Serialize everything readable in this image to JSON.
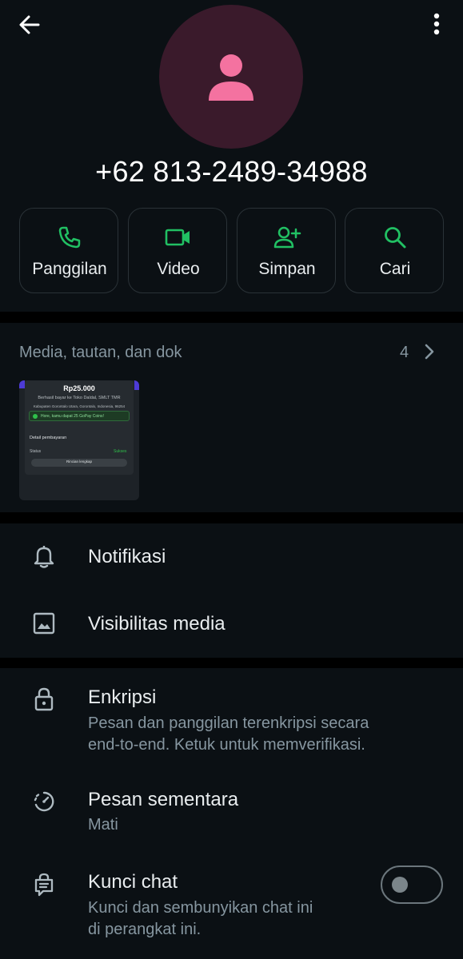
{
  "header": {
    "back_icon": "arrow-left-icon",
    "menu_icon": "more-vert-icon",
    "avatar_icon": "person-icon",
    "avatar_color": "#3a1a2b",
    "avatar_icon_color": "#f472a0",
    "phone": "+62 813-2489-34988"
  },
  "actions": [
    {
      "label": "Panggilan",
      "icon": "phone-icon"
    },
    {
      "label": "Video",
      "icon": "video-icon"
    },
    {
      "label": "Simpan",
      "icon": "add-person-icon"
    },
    {
      "label": "Cari",
      "icon": "search-icon"
    }
  ],
  "accent_color": "#21c063",
  "media": {
    "title": "Media, tautan, dan dok",
    "count": "4",
    "thumbnail": {
      "amount": "Rp25.000",
      "line1": "Berhasil bayar ke Toko Daldal, SMLT TMR",
      "line2": "Kabupaten Gorontalo Utara, Gorontalo, Indonesia, 96254",
      "promo": "Hore, kamu dapat 25 GoPay Coins!",
      "detail": "Detail pembayaran",
      "status_label": "Status",
      "status_value": "Sukses",
      "button": "Rincian lengkap"
    }
  },
  "settings1": [
    {
      "title": "Notifikasi",
      "icon": "bell-icon"
    },
    {
      "title": "Visibilitas media",
      "icon": "image-icon"
    }
  ],
  "settings2": {
    "encryption": {
      "title": "Enkripsi",
      "sub1": "Pesan dan panggilan terenkripsi secara",
      "sub2": "end-to-end. Ketuk untuk memverifikasi.",
      "icon": "lock-icon"
    },
    "disappearing": {
      "title": "Pesan sementara",
      "sub": "Mati",
      "icon": "timer-icon"
    },
    "chat_lock": {
      "title": "Kunci chat",
      "sub1": "Kunci dan sembunyikan chat ini",
      "sub2": "di perangkat ini.",
      "icon": "chat-lock-icon",
      "enabled": false
    }
  }
}
